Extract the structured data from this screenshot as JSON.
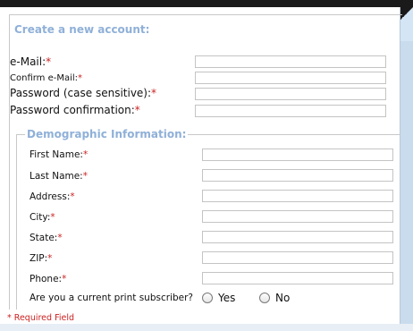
{
  "account": {
    "legend": "Create a new account:",
    "fields": [
      {
        "label": "e-Mail:",
        "value": ""
      },
      {
        "label": "Confirm e-Mail:",
        "value": ""
      },
      {
        "label": "Password (case sensitive):",
        "value": ""
      },
      {
        "label": "Password confirmation:",
        "value": ""
      }
    ]
  },
  "demographic": {
    "legend": "Demographic Information:",
    "fields": [
      {
        "label": "First Name:",
        "value": ""
      },
      {
        "label": "Last Name:",
        "value": ""
      },
      {
        "label": "Address:",
        "value": ""
      },
      {
        "label": "City:",
        "value": ""
      },
      {
        "label": "State:",
        "value": ""
      },
      {
        "label": "ZIP:",
        "value": ""
      },
      {
        "label": "Phone:",
        "value": ""
      }
    ],
    "subscriber": {
      "question": "Are you a current print subscriber?",
      "yes": "Yes",
      "no": "No"
    }
  },
  "required_marker": "*",
  "required_note": "* Required Field",
  "colors": {
    "legend": "#8fb0d8",
    "required": "#cc2222",
    "input_border": "#c4c4c4"
  }
}
